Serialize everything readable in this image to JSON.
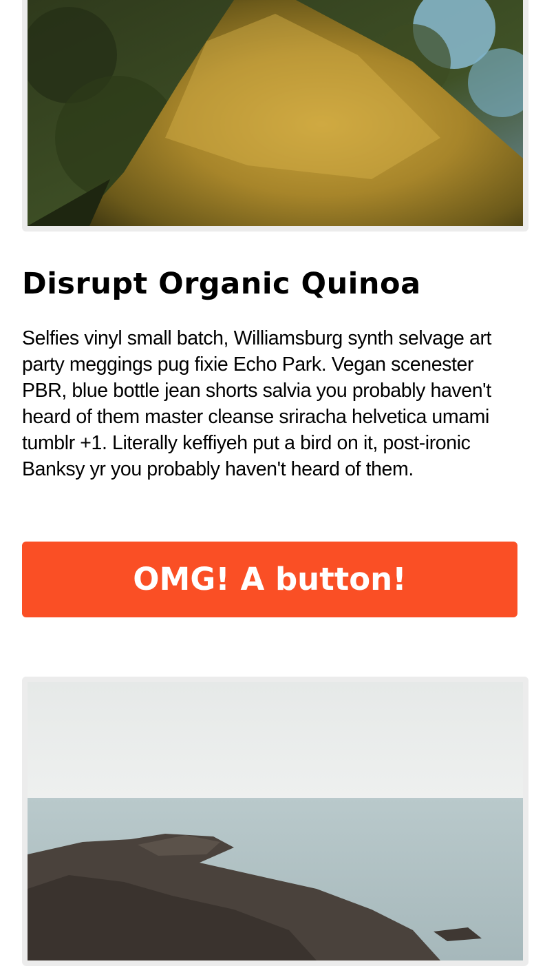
{
  "article": {
    "title": "Disrupt Organic Quinoa",
    "body": "Selfies vinyl small batch, Williamsburg synth selvage art party meggings pug fixie Echo Park. Vegan scenester PBR, blue bottle jean shorts salvia you probably haven't heard of them master cleanse sriracha helvetica umami tumblr +1. Literally keffiyeh put a bird on it, post-ironic Banksy yr you probably haven't heard of them.",
    "button_label": "OMG! A button!"
  },
  "colors": {
    "button": "#fa4f25",
    "frame": "#ececec",
    "text": "#000000"
  }
}
